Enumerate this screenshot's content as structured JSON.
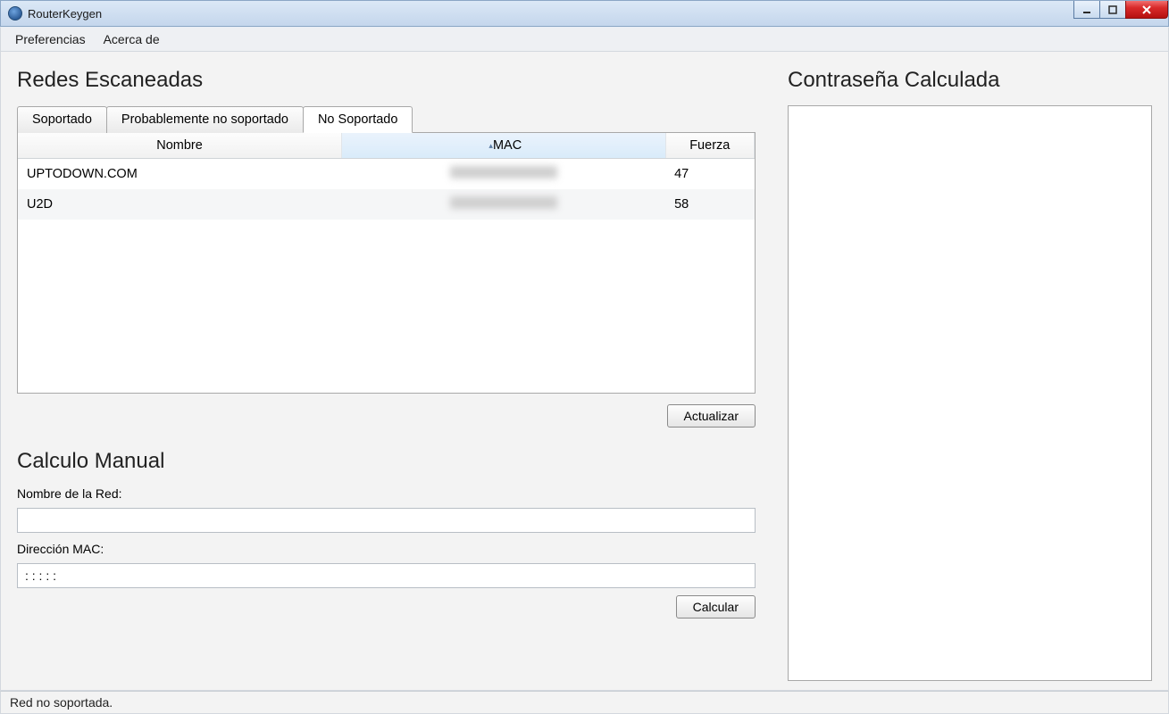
{
  "window": {
    "title": "RouterKeygen"
  },
  "menu": {
    "items": [
      "Preferencias",
      "Acerca de"
    ]
  },
  "sections": {
    "scanned": "Redes Escaneadas",
    "manual": "Calculo Manual",
    "password": "Contraseña Calculada"
  },
  "tabs": {
    "items": [
      "Soportado",
      "Probablemente no soportado",
      "No Soportado"
    ],
    "active_index": 2
  },
  "table": {
    "headers": {
      "name": "Nombre",
      "mac": "MAC",
      "strength": "Fuerza"
    },
    "sorted_column": "mac",
    "rows": [
      {
        "name": "UPTODOWN.COM",
        "mac_obscured": true,
        "strength": "47"
      },
      {
        "name": "U2D",
        "mac_obscured": true,
        "strength": "58"
      }
    ]
  },
  "buttons": {
    "refresh": "Actualizar",
    "calculate": "Calcular"
  },
  "manual_form": {
    "name_label": "Nombre de la Red:",
    "mac_label": "Dirección MAC:",
    "name_value": "",
    "mac_value": ": : : : :"
  },
  "status": "Red no soportada."
}
